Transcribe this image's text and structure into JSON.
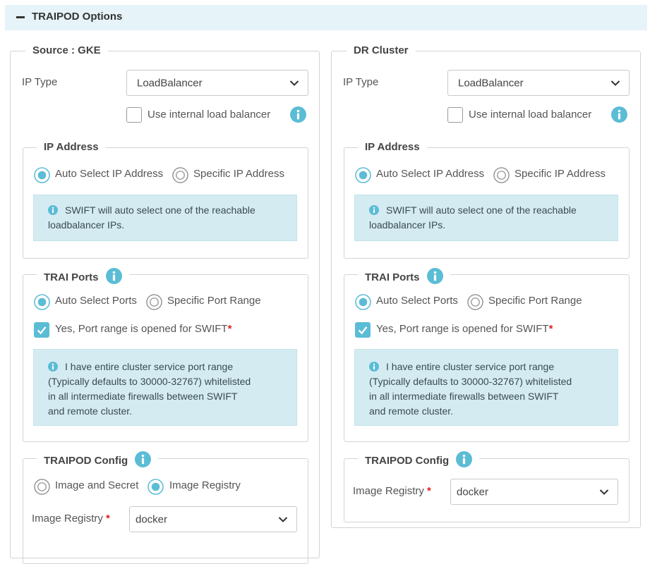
{
  "header": {
    "title": "TRAIPOD Options"
  },
  "source": {
    "legend": "Source : GKE",
    "ip_type_label": "IP Type",
    "ip_type_value": "LoadBalancer",
    "internal_lb_label": "Use internal load balancer",
    "ip_address": {
      "legend": "IP Address",
      "auto_label": "Auto Select IP Address",
      "specific_label": "Specific IP Address",
      "selected": "auto",
      "alert": "SWIFT will auto select one of the reachable loadbalancer IPs."
    },
    "trai_ports": {
      "legend": "TRAI Ports",
      "auto_label": "Auto Select Ports",
      "specific_label": "Specific Port Range",
      "selected": "auto",
      "confirm_label": "Yes, Port range is opened for SWIFT",
      "confirm_checked": true,
      "alert_lines": [
        "I have entire cluster service port range",
        "(Typically defaults to 30000-32767) whitelisted",
        "in all intermediate firewalls between SWIFT",
        "and remote cluster."
      ]
    },
    "traipod_config": {
      "legend": "TRAIPOD Config",
      "image_secret_label": "Image and Secret",
      "image_registry_radio_label": "Image Registry",
      "selected": "image-registry",
      "registry_label": "Image Registry",
      "registry_value": "docker"
    }
  },
  "dr": {
    "legend": "DR Cluster",
    "ip_type_label": "IP Type",
    "ip_type_value": "LoadBalancer",
    "internal_lb_label": "Use internal load balancer",
    "ip_address": {
      "legend": "IP Address",
      "auto_label": "Auto Select IP Address",
      "specific_label": "Specific IP Address",
      "selected": "auto",
      "alert": "SWIFT will auto select one of the reachable loadbalancer IPs."
    },
    "trai_ports": {
      "legend": "TRAI Ports",
      "auto_label": "Auto Select Ports",
      "specific_label": "Specific Port Range",
      "selected": "auto",
      "confirm_label": "Yes, Port range is opened for SWIFT",
      "confirm_checked": true,
      "alert_lines": [
        "I have entire cluster service port range",
        "(Typically defaults to 30000-32767) whitelisted",
        "in all intermediate firewalls between SWIFT",
        "and remote cluster."
      ]
    },
    "traipod_config": {
      "legend": "TRAIPOD Config",
      "registry_label": "Image Registry",
      "registry_value": "docker"
    }
  },
  "colors": {
    "accent": "#5bbcd6",
    "header_bg": "#e6f3f8",
    "alert_bg": "#d4ecf1",
    "required": "#e02020"
  }
}
